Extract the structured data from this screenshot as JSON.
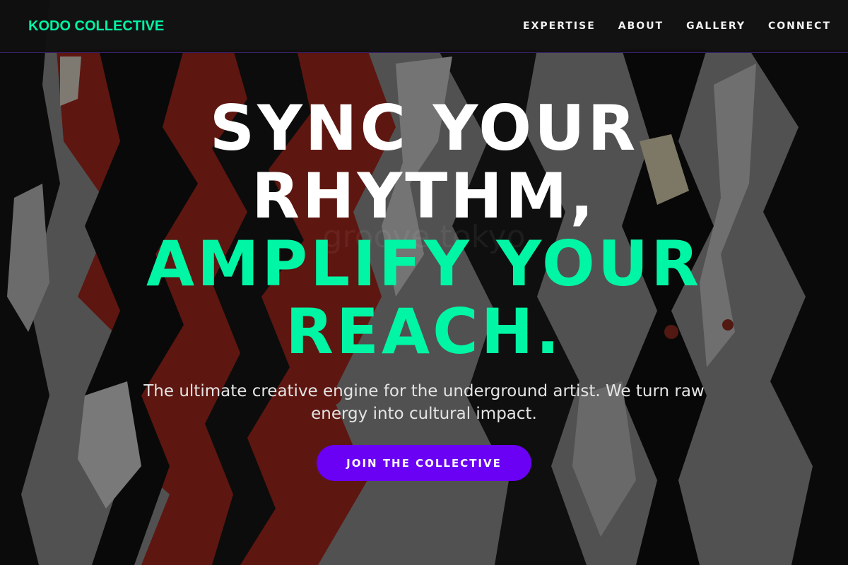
{
  "header": {
    "brand": "KODO COLLECTIVE",
    "nav": [
      {
        "label": "EXPERTISE"
      },
      {
        "label": "ABOUT"
      },
      {
        "label": "GALLERY"
      },
      {
        "label": "CONNECT"
      }
    ]
  },
  "hero": {
    "headline": {
      "line1": "SYNC YOUR",
      "line2": "RHYTHM,",
      "line3": "AMPLIFY YOUR",
      "line4": "REACH."
    },
    "subtext": "The ultimate creative engine for the underground artist. We turn raw energy into cultural impact.",
    "cta_label": "JOIN THE COLLECTIVE",
    "background_watermark": "groove tokyo"
  },
  "colors": {
    "accent_green": "#00f5a4",
    "cta_purple": "#6a00f4",
    "header_bg": "#101010",
    "poster_red": "#a3261c"
  },
  "icons": []
}
